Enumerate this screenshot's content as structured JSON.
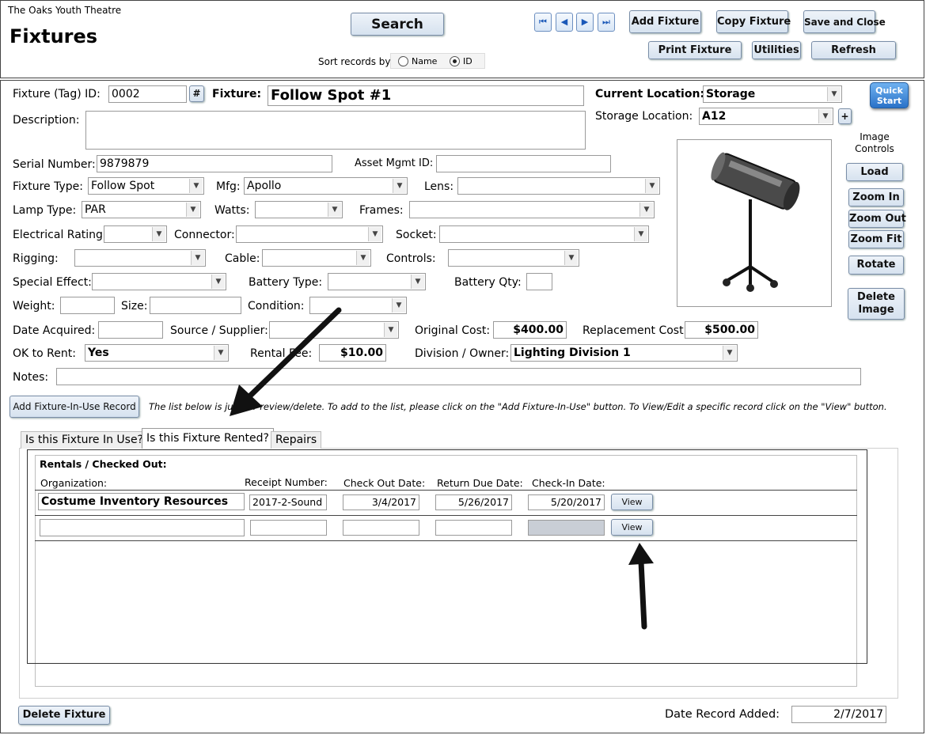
{
  "header": {
    "org_name": "The Oaks Youth Theatre",
    "title": "Fixtures",
    "search_label": "Search",
    "sort_label": "Sort records by:",
    "sort_name": "Name",
    "sort_id": "ID",
    "sort_selected": "ID",
    "nav_first": "⏮",
    "nav_prev": "◀",
    "nav_next": "▶",
    "nav_last": "⏭",
    "add_fixture": "Add Fixture",
    "copy_fixture": "Copy Fixture",
    "save_close": "Save and Close",
    "print_fixture": "Print Fixture",
    "utilities": "Utilities",
    "refresh": "Refresh"
  },
  "form": {
    "tag_id_label": "Fixture (Tag) ID:",
    "tag_id": "0002",
    "hash_btn": "#",
    "fixture_label": "Fixture:",
    "fixture": "Follow Spot #1",
    "description_label": "Description:",
    "description": "",
    "current_location_label": "Current Location:",
    "current_location": "Storage",
    "storage_location_label": "Storage Location:",
    "storage_location": "A12",
    "plus_btn": "+",
    "serial_label": "Serial Number:",
    "serial": "9879879",
    "asset_label": "Asset Mgmt ID:",
    "asset": "",
    "fixture_type_label": "Fixture Type:",
    "fixture_type": "Follow Spot",
    "mfg_label": "Mfg:",
    "mfg": "Apollo",
    "lens_label": "Lens:",
    "lens": "",
    "lamp_type_label": "Lamp Type:",
    "lamp_type": "PAR",
    "watts_label": "Watts:",
    "watts": "",
    "frames_label": "Frames:",
    "frames": "",
    "electrical_label": "Electrical Rating:",
    "electrical": "",
    "connector_label": "Connector:",
    "connector": "",
    "socket_label": "Socket:",
    "socket": "",
    "rigging_label": "Rigging:",
    "rigging": "",
    "cable_label": "Cable:",
    "cable": "",
    "controls_label": "Controls:",
    "controls": "",
    "special_label": "Special Effect:",
    "special": "",
    "battery_type_label": "Battery Type:",
    "battery_type": "",
    "battery_qty_label": "Battery Qty:",
    "battery_qty": "",
    "weight_label": "Weight:",
    "weight": "",
    "size_label": "Size:",
    "size": "",
    "condition_label": "Condition:",
    "condition": "",
    "date_acq_label": "Date Acquired:",
    "date_acq": "",
    "source_label": "Source / Supplier:",
    "source": "",
    "orig_cost_label": "Original Cost:",
    "orig_cost": "$400.00",
    "repl_cost_label": "Replacement Cost:",
    "repl_cost": "$500.00",
    "ok_rent_label": "OK to Rent:",
    "ok_rent": "Yes",
    "rental_fee_label": "Rental Fee:",
    "rental_fee": "$10.00",
    "division_label": "Division / Owner:",
    "division": "Lighting Division 1",
    "notes_label": "Notes:",
    "notes": ""
  },
  "image_panel": {
    "quick_start": "Quick Start",
    "controls_label": "Image Controls",
    "load": "Load",
    "zoom_in": "Zoom In",
    "zoom_out": "Zoom Out",
    "zoom_fit": "Zoom Fit",
    "rotate": "Rotate",
    "delete_image": "Delete Image"
  },
  "fixture_in_use": {
    "add_btn": "Add Fixture-In-Use Record",
    "instructions": "The list below is just for review/delete.  To add to the list, please click on the \"Add Fixture-In-Use\" button.  To View/Edit a specific record click on the \"View\" button."
  },
  "tabs": [
    {
      "label": "Is this Fixture In Use?"
    },
    {
      "label": "Is this Fixture Rented?"
    },
    {
      "label": "Repairs"
    }
  ],
  "rentals": {
    "section_title": "Rentals / Checked Out:",
    "col_org": "Organization:",
    "col_receipt": "Receipt Number:",
    "col_checkout": "Check Out Date:",
    "col_due": "Return Due Date:",
    "col_checkin": "Check-In Date:",
    "rows": [
      {
        "org": "Costume Inventory Resources",
        "receipt": "2017-2-Sound",
        "checkout": "3/4/2017",
        "due": "5/26/2017",
        "checkin": "5/20/2017",
        "view": "View"
      },
      {
        "org": "",
        "receipt": "",
        "checkout": "",
        "due": "",
        "checkin": "",
        "view": "View"
      }
    ]
  },
  "footer": {
    "delete_fixture": "Delete Fixture",
    "date_added_label": "Date Record Added:",
    "date_added": "2/7/2017"
  }
}
